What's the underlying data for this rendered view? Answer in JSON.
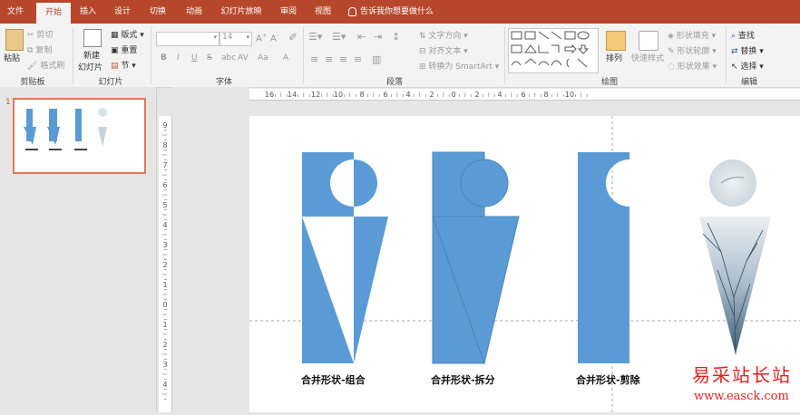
{
  "tabs": [
    {
      "label": "文件"
    },
    {
      "label": "开始"
    },
    {
      "label": "插入"
    },
    {
      "label": "设计"
    },
    {
      "label": "切换"
    },
    {
      "label": "动画"
    },
    {
      "label": "幻灯片放映"
    },
    {
      "label": "审阅"
    },
    {
      "label": "视图"
    }
  ],
  "tell_me": "告诉我你想要做什么",
  "clipboard": {
    "paste": "粘贴",
    "cut": "剪切",
    "copy": "复制",
    "format_painter": "格式刷",
    "group": "剪贴板"
  },
  "slides_group": {
    "new_slide_1": "新建",
    "new_slide_2": "幻灯片",
    "layout": "版式",
    "reset": "重置",
    "section": "节",
    "group": "幻灯片"
  },
  "font_group": {
    "font_name": "",
    "font_size": "14",
    "group": "字体",
    "bold": "B",
    "italic": "I",
    "underline": "U",
    "strike": "S",
    "shadow": "abc",
    "spacing": "AV",
    "case": "Aa",
    "color": "A"
  },
  "paragraph_group": {
    "text_direction": "文字方向",
    "align_text": "对齐文本",
    "smartart": "转换为 SmartArt",
    "group": "段落"
  },
  "drawing_group": {
    "arrange": "排列",
    "quick_styles": "快速样式",
    "shape_fill": "形状填充",
    "shape_outline": "形状轮廓",
    "shape_effects": "形状效果",
    "group": "绘图"
  },
  "editing_group": {
    "find": "查找",
    "replace": "替换",
    "select": "选择",
    "group": "编辑"
  },
  "thumbnail": {
    "number": "1"
  },
  "ruler": {
    "h_ticks": [
      "16",
      "14",
      "12",
      "10",
      "8",
      "6",
      "4",
      "2",
      "0",
      "2",
      "4",
      "6",
      "8",
      "10"
    ],
    "v_ticks": [
      "9",
      "8",
      "7",
      "6",
      "5",
      "4",
      "3",
      "2",
      "1",
      "0",
      "1",
      "2",
      "3",
      "4"
    ]
  },
  "slide": {
    "captions": [
      "合并形状-组合",
      "合并形状-拆分",
      "合并形状-剪除"
    ],
    "shape_color": "#5b9bd5"
  },
  "watermark": {
    "line1": "易采站长站",
    "line2": "www.easck.com"
  }
}
